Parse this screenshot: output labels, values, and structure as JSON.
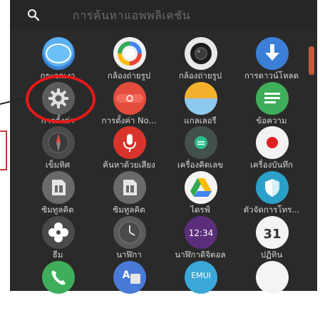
{
  "search": {
    "placeholder": "การค้นหาแอพพลิเคชัน"
  },
  "apps": [
    {
      "label": "กระจกเงา",
      "icon": "mirror-icon"
    },
    {
      "label": "กล้องถ่ายรูป",
      "icon": "google-camera-icon"
    },
    {
      "label": "กล้องถ่ายรูป",
      "icon": "camera-icon"
    },
    {
      "label": "การดาวน์โหลด",
      "icon": "download-icon"
    },
    {
      "label": "การตั้งค่า",
      "icon": "settings-gear-icon"
    },
    {
      "label": "การตั้งค่า No...",
      "icon": "nova-settings-icon"
    },
    {
      "label": "แกลเลอรี",
      "icon": "gallery-icon"
    },
    {
      "label": "ข้อความ",
      "icon": "messages-icon"
    },
    {
      "label": "เข็มทิศ",
      "icon": "compass-icon"
    },
    {
      "label": "ค้นหาด้วยเสียง",
      "icon": "voice-search-icon"
    },
    {
      "label": "เครื่องคิดเลข",
      "icon": "calculator-icon"
    },
    {
      "label": "เครื่องบันทึก",
      "icon": "recorder-icon"
    },
    {
      "label": "ซิมทูลคิต",
      "icon": "sim-toolkit-icon"
    },
    {
      "label": "ซิมทูลคิต",
      "icon": "sim-toolkit-icon"
    },
    {
      "label": "ไดรฟ์",
      "icon": "drive-icon"
    },
    {
      "label": "ตัวจัดการโทร...",
      "icon": "phone-manager-icon"
    },
    {
      "label": "ธีม",
      "icon": "themes-icon"
    },
    {
      "label": "นาฬิกา",
      "icon": "clock-icon"
    },
    {
      "label": "นาฬิกาดิจิตอล",
      "icon": "digital-clock-icon",
      "time": "12:34"
    },
    {
      "label": "ปฏิทิน",
      "icon": "calendar-icon",
      "day": "31"
    },
    {
      "label": "",
      "icon": "phone-icon"
    },
    {
      "label": "",
      "icon": "translate-icon"
    },
    {
      "label": "",
      "icon": "emui-icon",
      "text": "EMUI"
    },
    {
      "label": "",
      "icon": "notes-icon"
    }
  ],
  "colors": {
    "background": "#2a2a2a",
    "annotation": "#e81818",
    "label": "#d8d8d8"
  }
}
